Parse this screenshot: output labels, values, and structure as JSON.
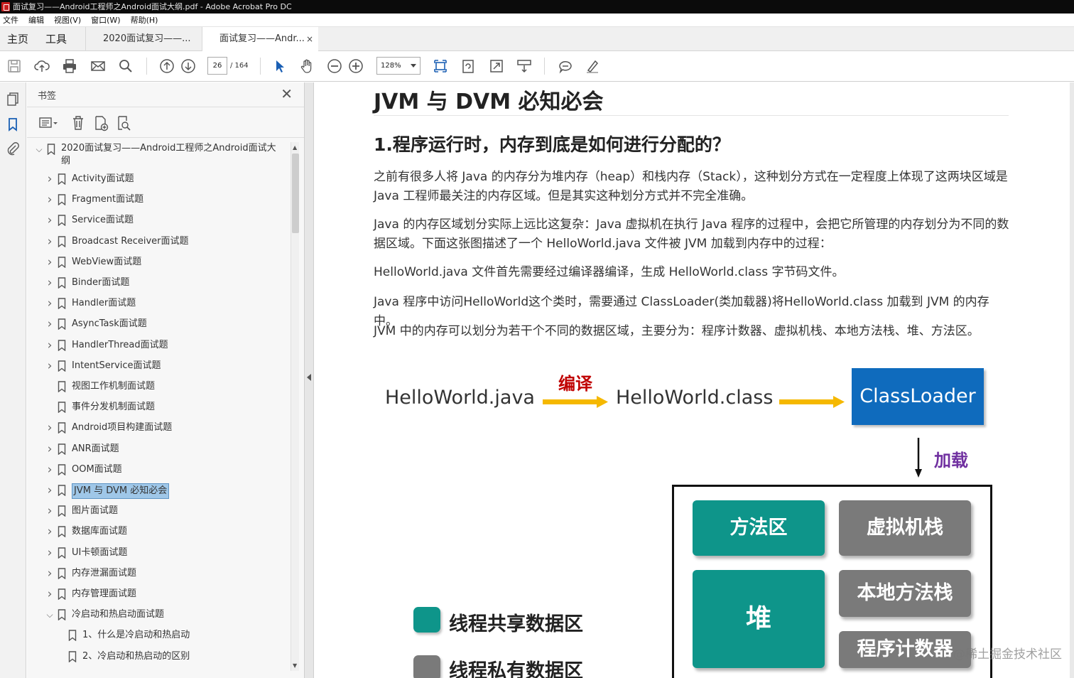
{
  "window": {
    "title": "面试复习——Android工程师之Android面试大纲.pdf - Adobe Acrobat Pro DC"
  },
  "menu": [
    "文件",
    "编辑",
    "视图(V)",
    "窗口(W)",
    "帮助(H)"
  ],
  "tabs": {
    "home": "主页",
    "tools": "工具",
    "docs": [
      {
        "label": "2020面试复习——...",
        "active": false
      },
      {
        "label": "面试复习——Andr...",
        "active": true
      }
    ],
    "close": "×"
  },
  "toolbar": {
    "page_current": "26",
    "page_total": "/ 164",
    "zoom": "128%"
  },
  "bookmarks_panel": {
    "title": "书签",
    "close": "✕",
    "items": [
      {
        "label": "2020面试复习——Android工程师之Android面试大纲",
        "level": 0,
        "expand": "open"
      },
      {
        "label": "Activity面试题",
        "level": 1,
        "expand": "closed"
      },
      {
        "label": "Fragment面试题",
        "level": 1,
        "expand": "closed"
      },
      {
        "label": "Service面试题",
        "level": 1,
        "expand": "closed"
      },
      {
        "label": "Broadcast Receiver面试题",
        "level": 1,
        "expand": "closed"
      },
      {
        "label": "WebView面试题",
        "level": 1,
        "expand": "closed"
      },
      {
        "label": "Binder面试题",
        "level": 1,
        "expand": "closed"
      },
      {
        "label": "Handler面试题",
        "level": 1,
        "expand": "closed"
      },
      {
        "label": "AsyncTask面试题",
        "level": 1,
        "expand": "closed"
      },
      {
        "label": "HandlerThread面试题",
        "level": 1,
        "expand": "closed"
      },
      {
        "label": "IntentService面试题",
        "level": 1,
        "expand": "closed"
      },
      {
        "label": "视图工作机制面试题",
        "level": 1,
        "expand": "none"
      },
      {
        "label": "事件分发机制面试题",
        "level": 1,
        "expand": "none"
      },
      {
        "label": "Android项目构建面试题",
        "level": 1,
        "expand": "closed"
      },
      {
        "label": "ANR面试题",
        "level": 1,
        "expand": "closed"
      },
      {
        "label": "OOM面试题",
        "level": 1,
        "expand": "closed"
      },
      {
        "label": "JVM 与 DVM 必知必会",
        "level": 1,
        "expand": "closed",
        "selected": true
      },
      {
        "label": "图片面试题",
        "level": 1,
        "expand": "closed"
      },
      {
        "label": "数据库面试题",
        "level": 1,
        "expand": "closed"
      },
      {
        "label": "UI卡顿面试题",
        "level": 1,
        "expand": "closed"
      },
      {
        "label": "内存泄漏面试题",
        "level": 1,
        "expand": "closed"
      },
      {
        "label": "内存管理面试题",
        "level": 1,
        "expand": "closed"
      },
      {
        "label": "冷启动和热启动面试题",
        "level": 1,
        "expand": "open"
      },
      {
        "label": "1、什么是冷启动和热启动",
        "level": 2,
        "expand": "none"
      },
      {
        "label": "2、冷启动和热启动的区别",
        "level": 2,
        "expand": "none"
      }
    ]
  },
  "document": {
    "heading": "JVM 与 DVM 必知必会",
    "subheading": "1.程序运行时，内存到底是如何进行分配的？",
    "paragraphs": [
      "之前有很多人将 Java 的内存分为堆内存（heap）和栈内存（Stack），这种划分方式在一定程度上体现了这两块区域是 Java 工程师最关注的内存区域。但是其实这种划分方式并不完全准确。",
      "Java 的内存区域划分实际上远比这复杂：Java 虚拟机在执行 Java 程序的过程中，会把它所管理的内存划分为不同的数据区域。下面这张图描述了一个 HelloWorld.java 文件被 JVM 加载到内存中的过程：",
      "HelloWorld.java 文件首先需要经过编译器编译，生成 HelloWorld.class 字节码文件。",
      "Java 程序中访问HelloWorld这个类时，需要通过 ClassLoader(类加载器)将HelloWorld.class 加载到 JVM 的内存中。",
      "JVM 中的内存可以划分为若干个不同的数据区域，主要分为：程序计数器、虚拟机栈、本地方法栈、堆、方法区。"
    ],
    "diagram": {
      "source": "HelloWorld.java",
      "compile_label": "编译",
      "compiled": "HelloWorld.class",
      "loader": "ClassLoader",
      "load_label": "加载",
      "areas": {
        "method": "方法区",
        "vm_stack": "虚拟机栈",
        "heap": "堆",
        "native_stack": "本地方法栈",
        "pc": "程序计数器"
      },
      "legend": {
        "shared": "线程共享数据区",
        "private": "线程私有数据区"
      },
      "colors": {
        "shared": "#0e958a",
        "private": "#7a7a7a",
        "loader": "#0f6bbd",
        "arrow": "#f5b800"
      }
    },
    "watermark": "@稀土掘金技术社区"
  }
}
